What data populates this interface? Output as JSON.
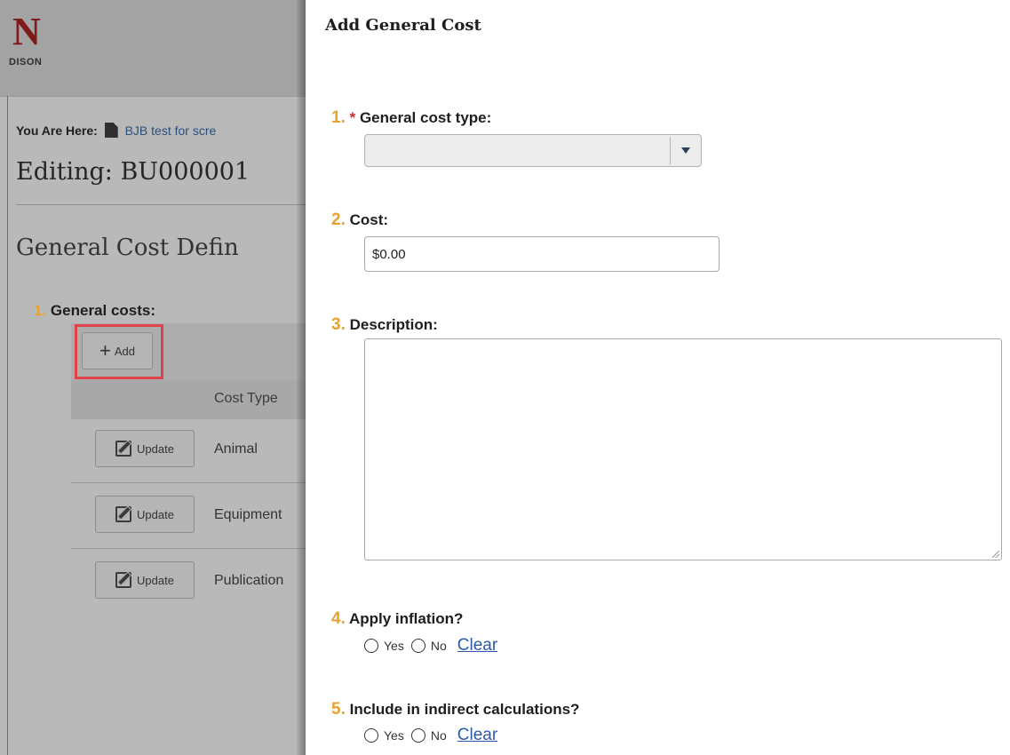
{
  "background": {
    "logo_letter": "N",
    "logo_sub": "DISON",
    "breadcrumb_label": "You Are Here:",
    "breadcrumb_link": "BJB test for scre",
    "editing_title": "Editing: BU000001",
    "section_title": "General Cost Defin",
    "question1_num": "1.",
    "question1_label": "General costs:",
    "add_label": "Add",
    "column_header": "Cost Type",
    "update_label": "Update",
    "rows": [
      "Animal",
      "Equipment",
      "Publication"
    ]
  },
  "dialog": {
    "title": "Add General Cost",
    "q1": {
      "num": "1.",
      "required": "*",
      "label": "General cost type:",
      "value": ""
    },
    "q2": {
      "num": "2.",
      "label": "Cost:",
      "value": "$0.00"
    },
    "q3": {
      "num": "3.",
      "label": "Description:",
      "value": ""
    },
    "q4": {
      "num": "4.",
      "label": "Apply inflation?"
    },
    "q5": {
      "num": "5.",
      "label": "Include in indirect calculations?"
    },
    "radio": {
      "yes": "Yes",
      "no": "No",
      "clear": "Clear"
    }
  },
  "colors": {
    "accent_number": "#e7a232",
    "required": "#cc2b2b",
    "link": "#2b5aa8",
    "highlight": "#e0434a"
  }
}
